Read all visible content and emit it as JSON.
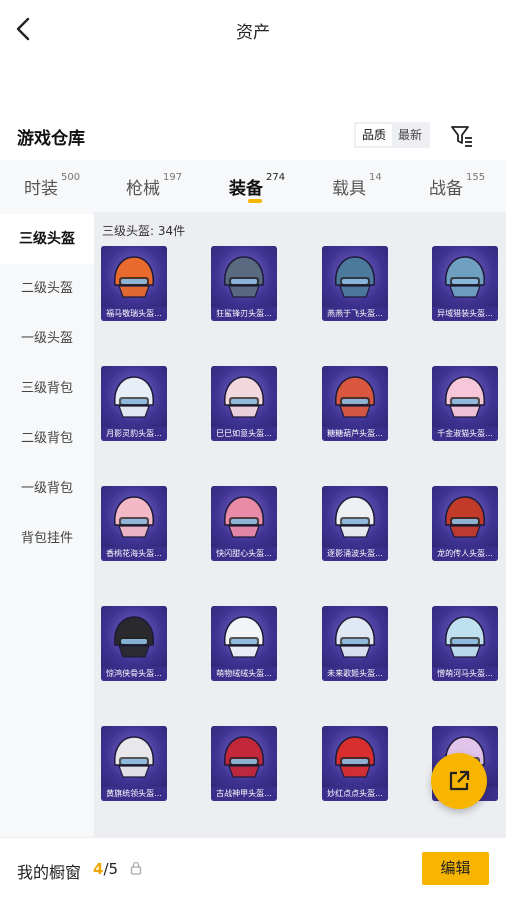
{
  "header": {
    "title": "资产"
  },
  "section": {
    "title": "游戏仓库",
    "sort_options": [
      "品质",
      "最新"
    ]
  },
  "tabs": [
    {
      "label": "时装",
      "count": "500"
    },
    {
      "label": "枪械",
      "count": "197"
    },
    {
      "label": "装备",
      "count": "274"
    },
    {
      "label": "载具",
      "count": "14"
    },
    {
      "label": "战备",
      "count": "155"
    }
  ],
  "sidebar": {
    "items": [
      {
        "label": "三级头盔"
      },
      {
        "label": "二级头盔"
      },
      {
        "label": "一级头盔"
      },
      {
        "label": "三级背包"
      },
      {
        "label": "二级背包"
      },
      {
        "label": "一级背包"
      },
      {
        "label": "背包挂件"
      }
    ]
  },
  "grid": {
    "caption": "三级头盔: 34件",
    "items": [
      {
        "label": "福马敬瑞头盔...",
        "color": "#e86a2c"
      },
      {
        "label": "狂鲨锋刃头盔...",
        "color": "#5a6a80"
      },
      {
        "label": "燕燕于飞头盔...",
        "color": "#4b7a9c"
      },
      {
        "label": "异域猎装头盔...",
        "color": "#6fa0c2"
      },
      {
        "label": "月影灵豹头盔...",
        "color": "#e8eef6"
      },
      {
        "label": "巳巳如意头盔...",
        "color": "#f2d7dc"
      },
      {
        "label": "糖糖葫芦头盔...",
        "color": "#d9573f"
      },
      {
        "label": "千金淑猫头盔...",
        "color": "#f6c7d8"
      },
      {
        "label": "香桃花海头盔...",
        "color": "#f3b9c6"
      },
      {
        "label": "快闪甜心头盔...",
        "color": "#e98aa6"
      },
      {
        "label": "逐影涌波头盔...",
        "color": "#eef0f3"
      },
      {
        "label": "龙的传人头盔...",
        "color": "#c23a2a"
      },
      {
        "label": "惊鸿侠骨头盔...",
        "color": "#2a2a2e"
      },
      {
        "label": "萌物绒绒头盔...",
        "color": "#f2f4f8"
      },
      {
        "label": "未来歌姬头盔...",
        "color": "#dfe8f3"
      },
      {
        "label": "憎萌河马头盔...",
        "color": "#bfe0ef"
      },
      {
        "label": "黄旗统领头盔...",
        "color": "#e8e8ea"
      },
      {
        "label": "古战神甲头盔...",
        "color": "#c2283a"
      },
      {
        "label": "妙红点点头盔...",
        "color": "#d82e2e"
      },
      {
        "label": "",
        "color": "#e2c3ea"
      }
    ]
  },
  "bottom": {
    "showcase_label": "我的橱窗",
    "showcase_current": "4",
    "showcase_total": "/5",
    "edit_label": "编辑"
  },
  "colors": {
    "accent": "#f7b500",
    "card": "#4b3aa3"
  },
  "icons": {
    "back": "chevron-left-icon",
    "filter": "filter-icon",
    "share": "external-link-icon",
    "lock": "lock-icon"
  }
}
